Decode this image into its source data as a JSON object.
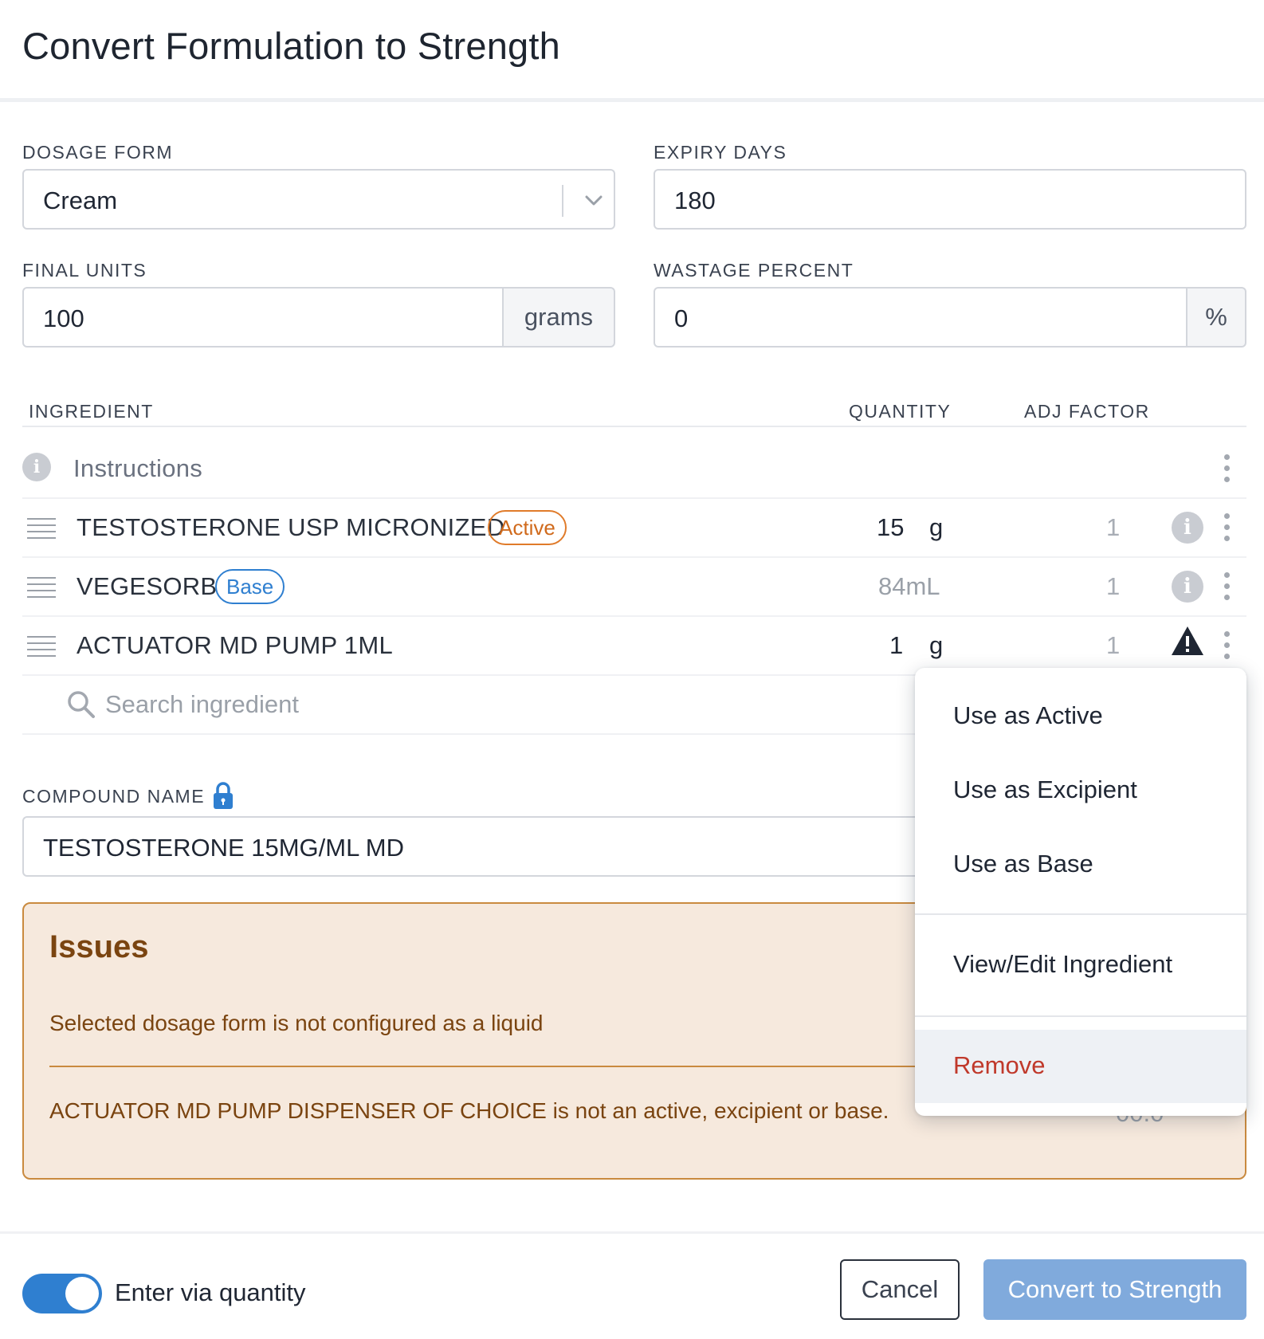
{
  "modal": {
    "title": "Convert Formulation to Strength"
  },
  "fields": {
    "dosage_form": {
      "label": "DOSAGE FORM",
      "value": "Cream"
    },
    "expiry_days": {
      "label": "EXPIRY DAYS",
      "value": "180"
    },
    "final_units": {
      "label": "FINAL UNITS",
      "value": "100",
      "unit": "grams"
    },
    "wastage_percent": {
      "label": "WASTAGE PERCENT",
      "value": "0",
      "unit": "%"
    }
  },
  "table": {
    "headers": {
      "ingredient": "INGREDIENT",
      "quantity": "QUANTITY",
      "adj_factor": "ADJ FACTOR"
    },
    "instructions_label": "Instructions",
    "rows": [
      {
        "name": "TESTOSTERONE USP MICRONIZED",
        "badge": "Active",
        "qty": "15",
        "unit": "g",
        "adj": "1"
      },
      {
        "name": "VEGESORB",
        "badge": "Base",
        "qty": "84mL",
        "adj": "1"
      },
      {
        "name": "ACTUATOR MD PUMP 1ML",
        "qty": "1",
        "unit": "g",
        "adj": "1"
      }
    ],
    "search_placeholder": "Search ingredient"
  },
  "compound": {
    "label": "COMPOUND NAME",
    "value": "TESTOSTERONE 15MG/ML MD"
  },
  "issues": {
    "title": "Issues",
    "messages": [
      "Selected dosage form is not configured as a liquid",
      "ACTUATOR MD PUMP DISPENSER OF CHOICE is not an active, excipient or base."
    ],
    "partial_value": "00.0"
  },
  "menu": {
    "items": [
      "Use as Active",
      "Use as Excipient",
      "Use as Base",
      "View/Edit Ingredient",
      "Remove"
    ]
  },
  "footer": {
    "toggle_label": "Enter via quantity",
    "toggle_on": true,
    "cancel_label": "Cancel",
    "submit_label": "Convert to Strength"
  },
  "colors": {
    "primary": "#2f7fd0",
    "primary_disabled": "#80aadc",
    "active_badge": "#e07b2a",
    "warning_bg": "#f6e9dd",
    "warning_text": "#7a4410",
    "danger": "#c0392b"
  },
  "icons": {
    "dropdown": "chevron-down-icon",
    "info": "info-icon",
    "drag": "drag-handle-icon",
    "kebab": "more-vertical-icon",
    "warning": "warning-icon",
    "search": "search-icon",
    "lock": "lock-icon"
  }
}
